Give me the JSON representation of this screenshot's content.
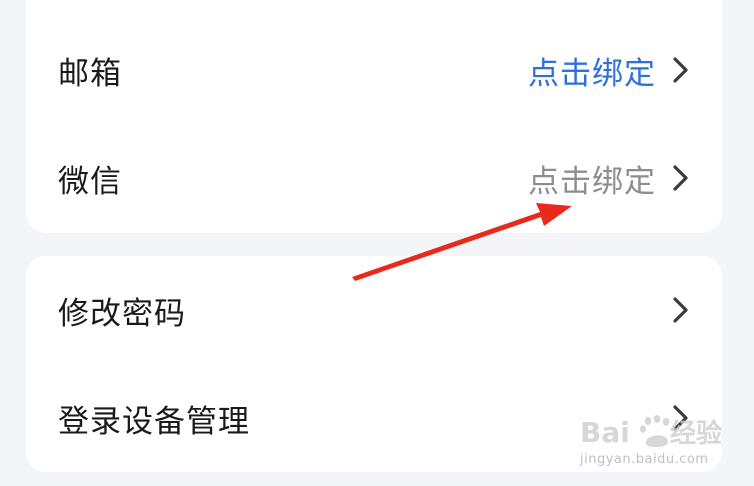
{
  "rows": [
    {
      "label": "邮箱",
      "value": "点击绑定"
    },
    {
      "label": "微信",
      "value": "点击绑定"
    },
    {
      "label": "修改密码"
    },
    {
      "label": "登录设备管理"
    }
  ],
  "colors": {
    "link_value": "#2f6fdc",
    "muted_value": "#8d8d8d",
    "annotation_arrow": "#e8291c"
  },
  "watermark": {
    "url": "jingyan.baidu.com"
  }
}
